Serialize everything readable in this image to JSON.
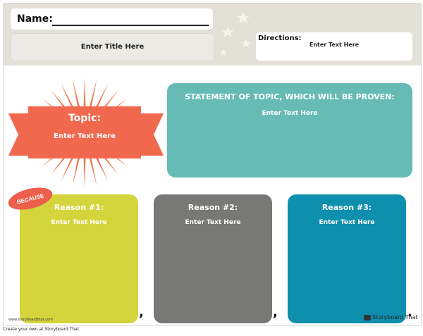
{
  "header": {
    "name_label": "Name:",
    "title_placeholder": "Enter Title Here",
    "directions_label": "Directions:",
    "directions_text": "Enter Text Here"
  },
  "topic": {
    "label": "Topic:",
    "text": "Enter Text Here",
    "color": "#f0694e",
    "burst_color": "#f1764e"
  },
  "statement": {
    "title": "STATEMENT OF TOPIC, WHICH WILL BE PROVEN:",
    "text": "Enter Text Here",
    "color": "#66bbb5"
  },
  "because_badge": {
    "label": "BECAUSE",
    "color": "#ec5f4d"
  },
  "reasons": [
    {
      "title": "Reason #1:",
      "text": "Enter Text Here",
      "color": "#d4d43c"
    },
    {
      "title": "Reason #2:",
      "text": "Enter Text Here",
      "color": "#787876"
    },
    {
      "title": "Reason #3:",
      "text": "Enter Text Here",
      "color": "#0e8fae"
    }
  ],
  "separators": [
    ",",
    ",",
    "."
  ],
  "watermark": {
    "url": "www.storyboardthat.com",
    "brand": "Storyboard That"
  },
  "footer": {
    "text": "Create your own at Storyboard That"
  }
}
